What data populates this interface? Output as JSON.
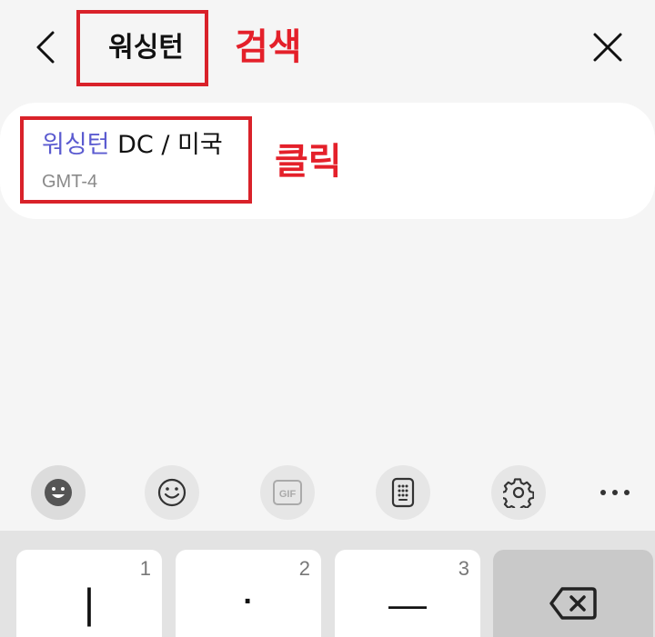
{
  "header": {
    "search_value": "워싱턴",
    "annotation": "검색"
  },
  "result": {
    "title_match": "워싱턴",
    "title_rest": " DC / 미국",
    "timezone": "GMT-4",
    "annotation": "클릭"
  },
  "toolbar": {
    "gif_label": "GIF",
    "icons": [
      "emoji-face-icon",
      "smiley-icon",
      "gif-icon",
      "keypad-icon",
      "gear-icon",
      "more-icon"
    ]
  },
  "keys": [
    {
      "number": "1",
      "symbol": "|"
    },
    {
      "number": "2",
      "symbol": "·"
    },
    {
      "number": "3",
      "symbol": "—"
    }
  ],
  "colors": {
    "annotation_red": "#e4202a",
    "match_highlight": "#5b5bd0"
  }
}
